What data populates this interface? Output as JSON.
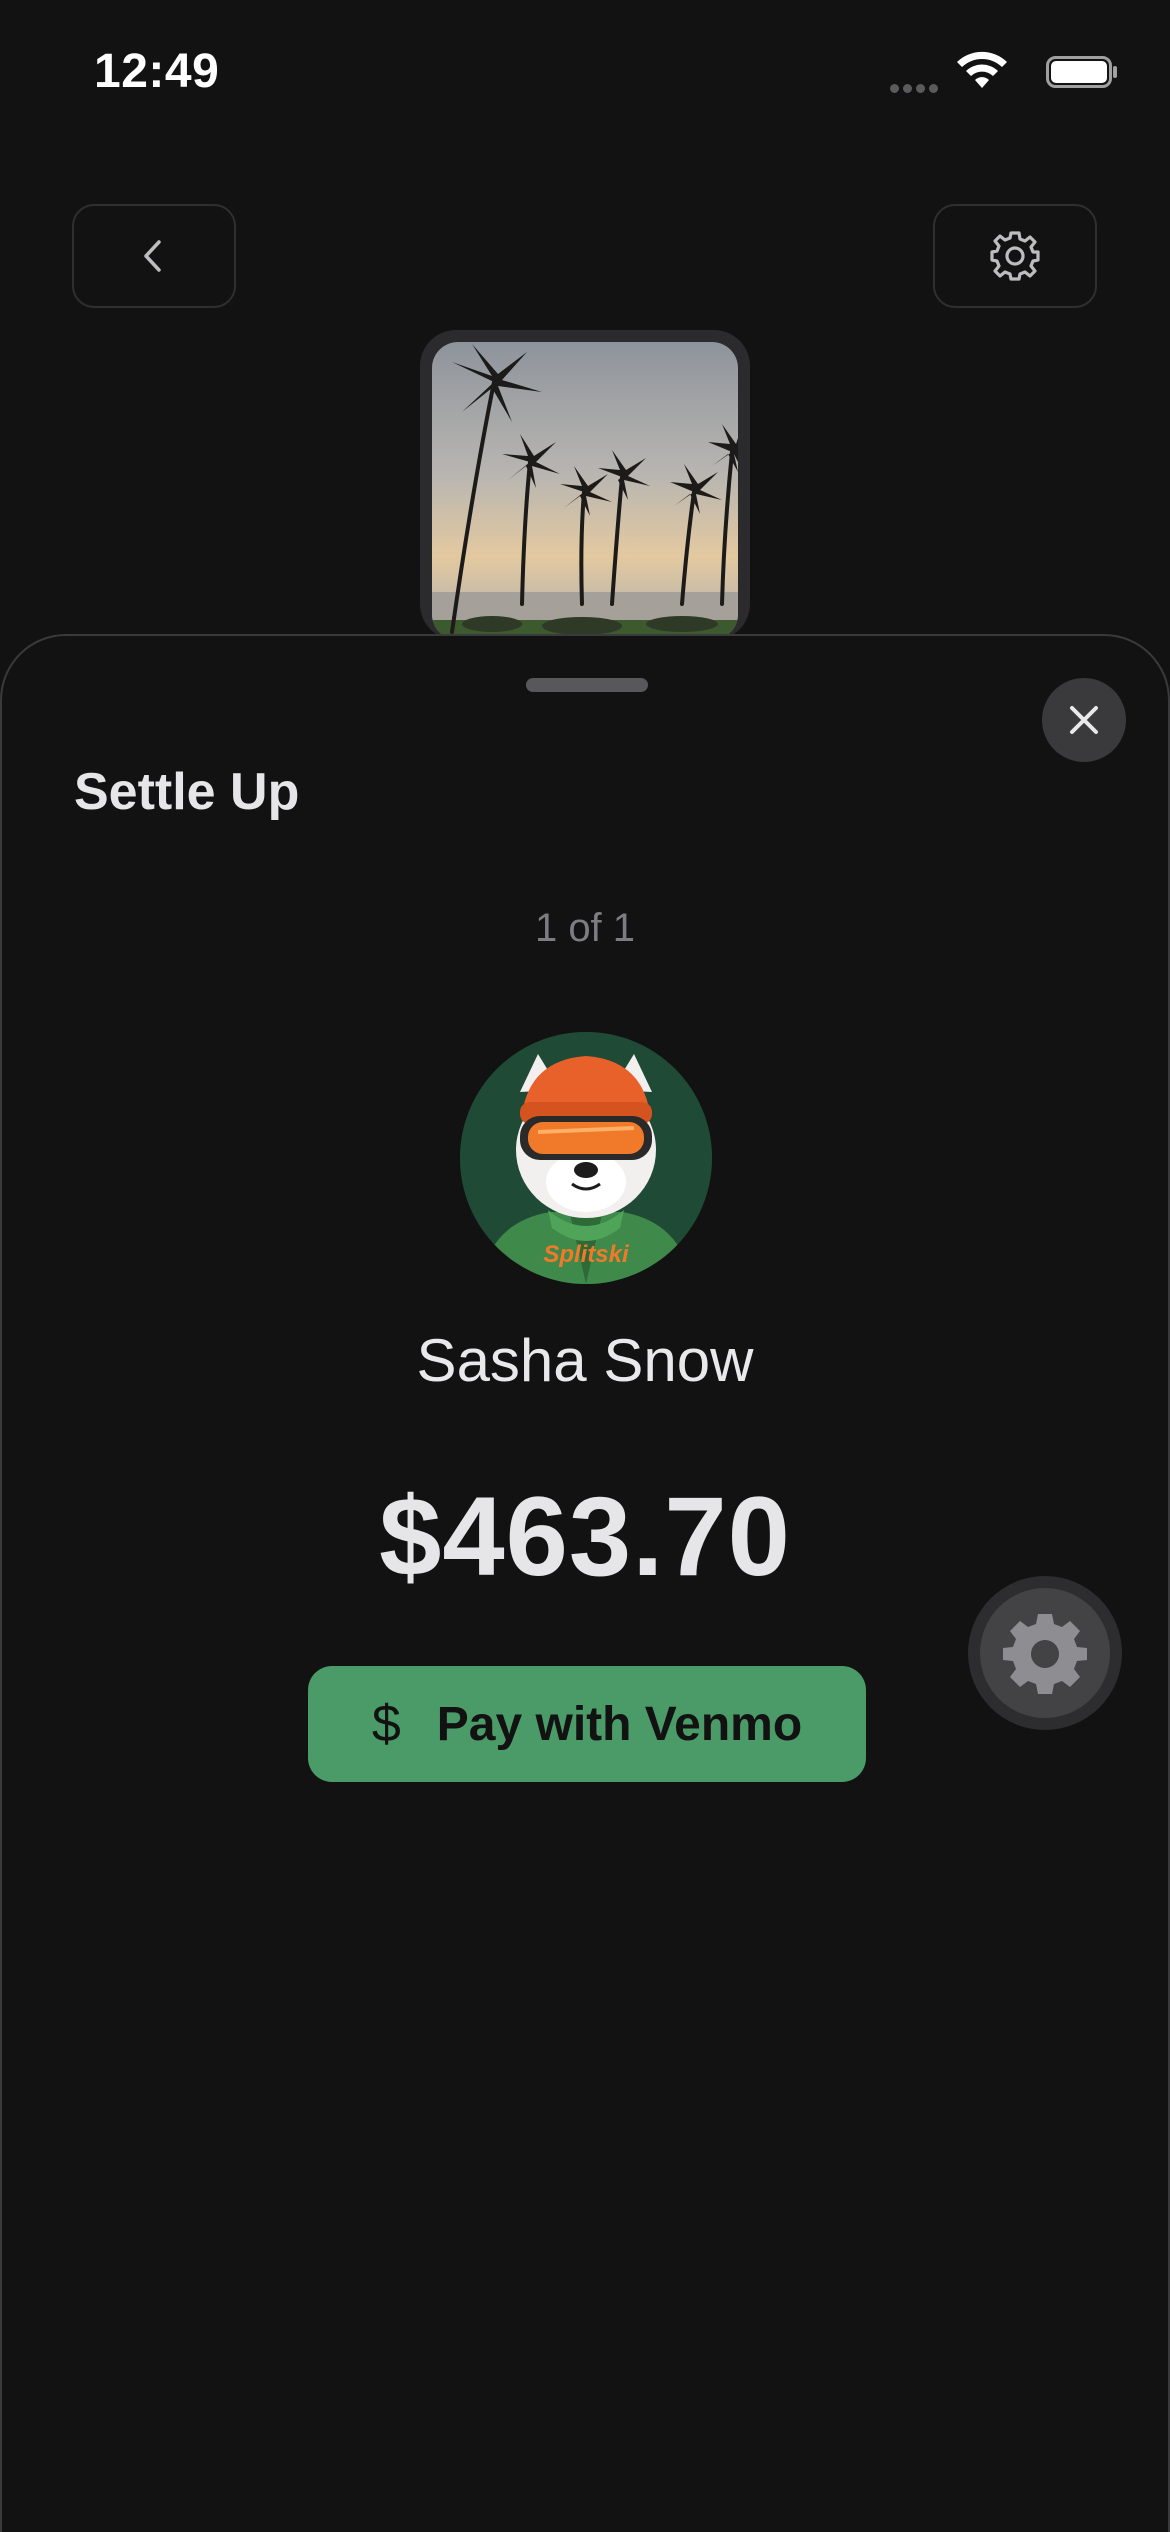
{
  "status_bar": {
    "time": "12:49"
  },
  "header": {
    "back_icon": "chevron-left-icon",
    "settings_icon": "gear-icon"
  },
  "sheet": {
    "title": "Settle Up",
    "pager": "1 of 1",
    "person": {
      "name": "Sasha Snow",
      "avatar_text": "Splitski"
    },
    "amount": "$463.70",
    "pay_button": {
      "icon": "dollar-icon",
      "label": "Pay with Venmo"
    }
  },
  "colors": {
    "background": "#131213",
    "accent_green": "#4a9b68",
    "text_primary": "#e9e8ea",
    "text_muted": "#7d7c80"
  }
}
